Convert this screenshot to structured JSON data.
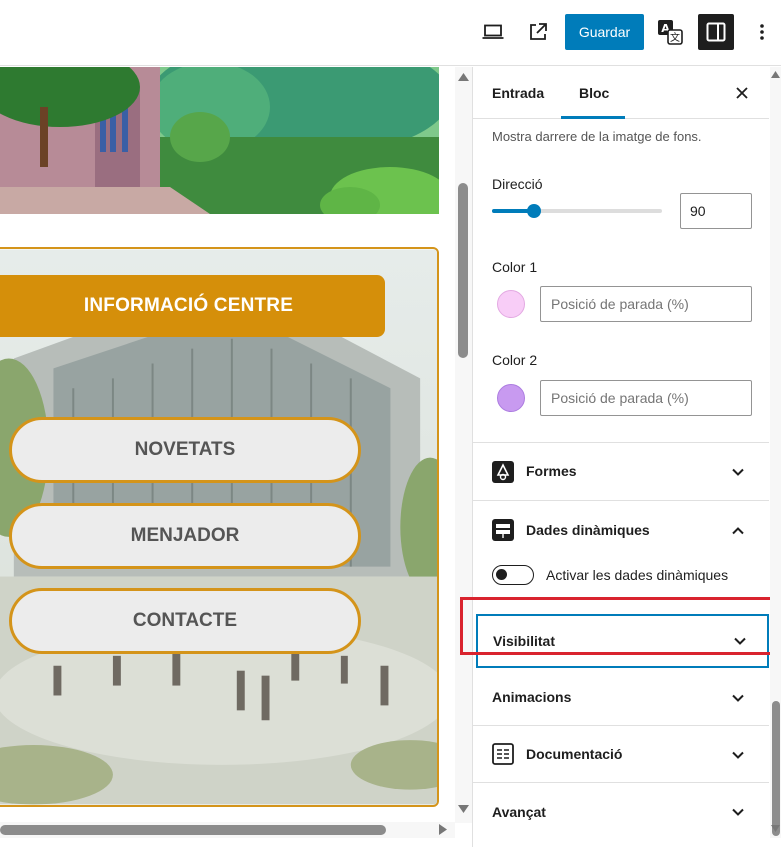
{
  "topbar": {
    "save_label": "Guardar",
    "icons": [
      "laptop-icon",
      "external-link-icon",
      "translate-icon",
      "sidebar-toggle-icon",
      "more-vertical-icon"
    ]
  },
  "canvas": {
    "info_button": "INFORMACIÓ CENTRE",
    "nav_buttons": [
      "NOVETATS",
      "MENJADOR",
      "CONTACTE"
    ],
    "accent_color": "#d58f0a",
    "border_color": "#d4941a"
  },
  "sidebar": {
    "tabs": [
      {
        "label": "Entrada",
        "active": false
      },
      {
        "label": "Bloc",
        "active": true
      }
    ],
    "help_text": "Mostra darrere de la imatge de fons.",
    "direction": {
      "label": "Direcció",
      "value": "90"
    },
    "color1": {
      "label": "Color 1",
      "placeholder": "Posició de parada (%)",
      "swatch": "#f8cdf7"
    },
    "color2": {
      "label": "Color 2",
      "placeholder": "Posició de parada (%)",
      "swatch": "#c89af0"
    },
    "sections": {
      "formes": "Formes",
      "dades": "Dades dinàmiques",
      "dades_toggle": "Activar les dades dinàmiques",
      "visibilitat": "Visibilitat",
      "animacions": "Animacions",
      "documentacio": "Documentació",
      "avancat": "Avançat"
    },
    "accent": "#007cba",
    "highlight": "#d9232e"
  }
}
